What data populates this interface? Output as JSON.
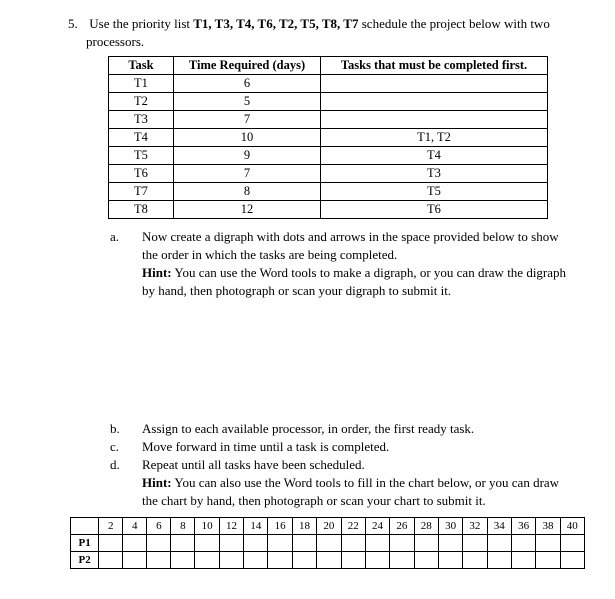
{
  "question": {
    "number": "5.",
    "text_before": "Use the priority list ",
    "priority_list": "T1, T3, T4, T6, T2, T5, T8, T7",
    "text_after": " schedule the project below with two",
    "text_line2": "processors."
  },
  "table": {
    "headers": [
      "Task",
      "Time Required (days)",
      "Tasks that must be completed first."
    ],
    "rows": [
      {
        "task": "T1",
        "time": "6",
        "dep": ""
      },
      {
        "task": "T2",
        "time": "5",
        "dep": ""
      },
      {
        "task": "T3",
        "time": "7",
        "dep": ""
      },
      {
        "task": "T4",
        "time": "10",
        "dep": "T1, T2"
      },
      {
        "task": "T5",
        "time": "9",
        "dep": "T4"
      },
      {
        "task": "T6",
        "time": "7",
        "dep": "T3"
      },
      {
        "task": "T7",
        "time": "8",
        "dep": "T5"
      },
      {
        "task": "T8",
        "time": "12",
        "dep": "T6"
      }
    ]
  },
  "parts": {
    "a": {
      "letter": "a.",
      "line1": "Now create a digraph with dots and arrows in the space provided below to show",
      "line2": "the order in which the tasks are being completed.",
      "hint_label": "Hint:",
      "hint_text": " You can use the Word tools to make a digraph, or you can draw the digraph",
      "hint_line2": "by hand, then photograph or scan your digraph to submit it."
    },
    "b": {
      "letter": "b.",
      "text": "Assign to each available processor, in order, the first ready task."
    },
    "c": {
      "letter": "c.",
      "text": "Move forward in time until a task is completed."
    },
    "d": {
      "letter": "d.",
      "text": "Repeat until all tasks have been scheduled.",
      "hint_label": "Hint:",
      "hint_text": " You can also use the Word tools to fill in the chart below, or you can draw",
      "hint_line2": "the chart by hand, then photograph or scan your chart to submit it."
    }
  },
  "schedule": {
    "rows": [
      "P1",
      "P2"
    ],
    "ticks": [
      "2",
      "4",
      "6",
      "8",
      "10",
      "12",
      "14",
      "16",
      "18",
      "20",
      "22",
      "24",
      "26",
      "28",
      "30",
      "32",
      "34",
      "36",
      "38",
      "40"
    ]
  }
}
